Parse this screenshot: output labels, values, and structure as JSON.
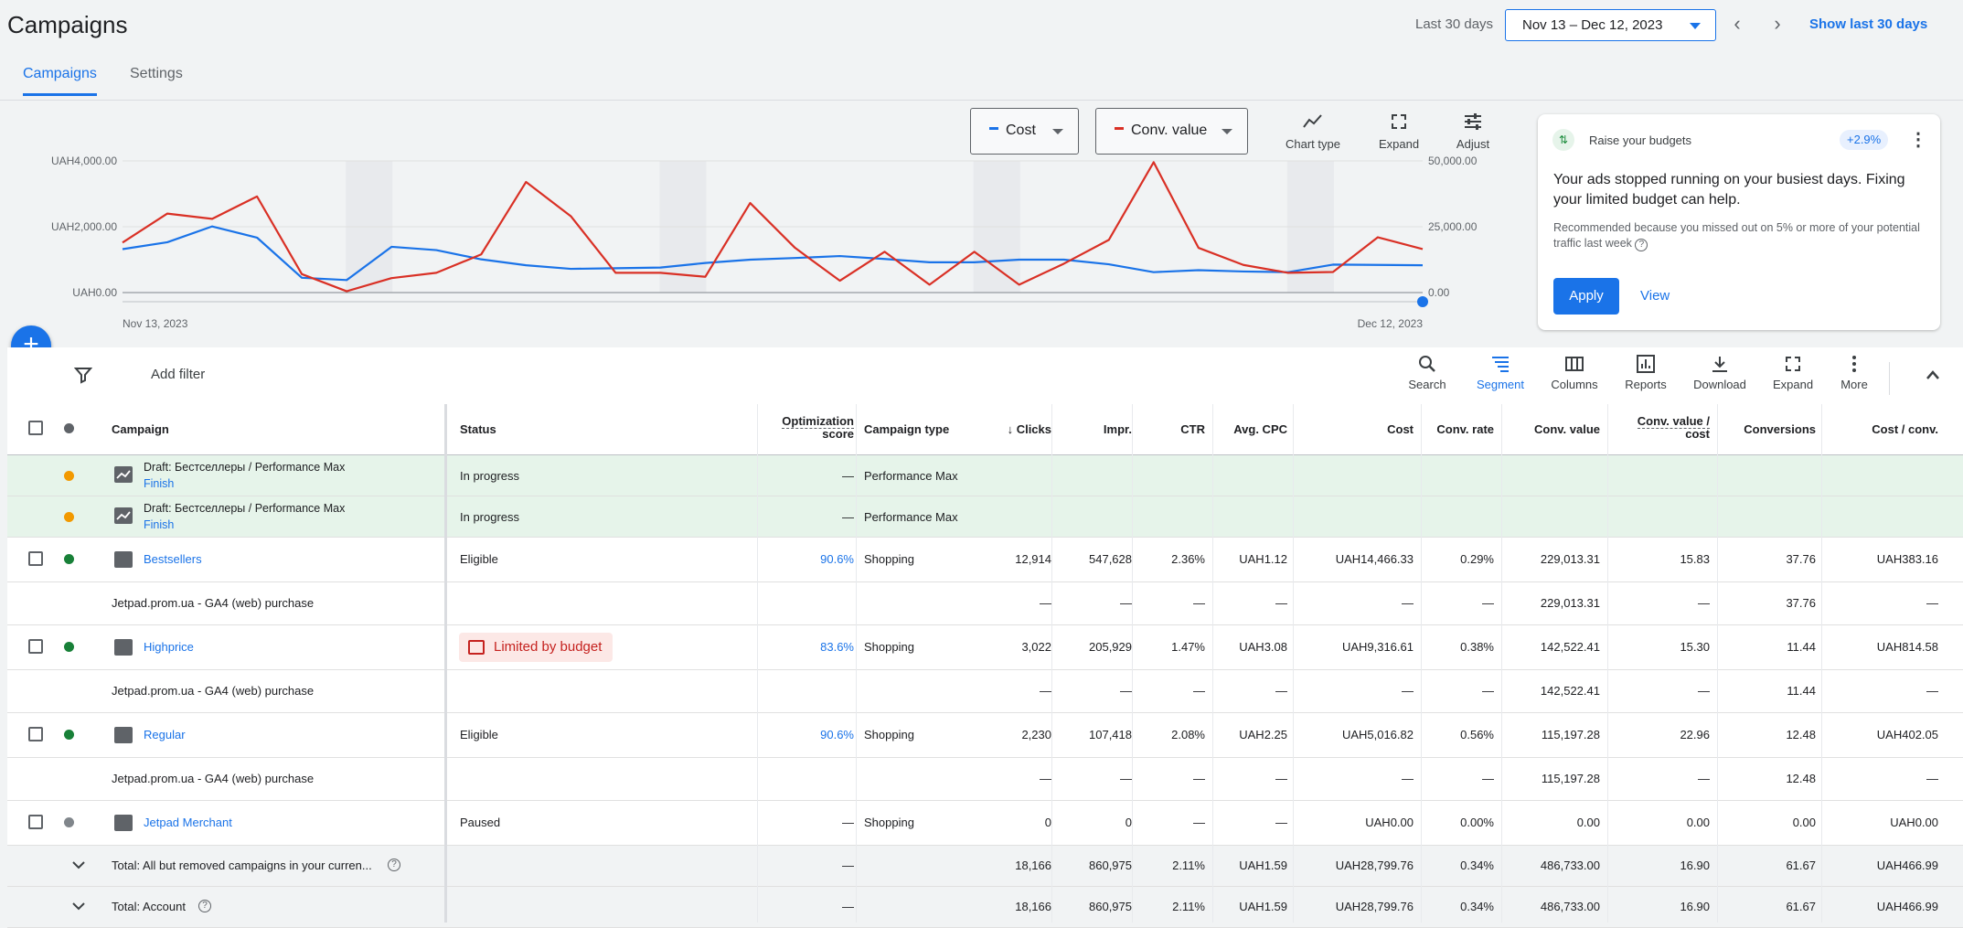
{
  "header": {
    "title": "Campaigns",
    "range_label": "Last 30 days",
    "date_range": "Nov 13 – Dec 12, 2023",
    "show_last": "Show last 30 days"
  },
  "tabs": [
    {
      "label": "Campaigns"
    },
    {
      "label": "Settings"
    }
  ],
  "chart_controls": {
    "metric1": "Cost",
    "metric2": "Conv. value",
    "chart_type": "Chart type",
    "expand": "Expand",
    "adjust": "Adjust",
    "metric1_color": "#1a73e8",
    "metric2_color": "#d93025"
  },
  "chart_data": {
    "type": "line",
    "x_start": "Nov 13, 2023",
    "x_end": "Dec 12, 2023",
    "left_ticks": [
      "UAH4,000.00",
      "UAH2,000.00",
      "UAH0.00"
    ],
    "right_ticks": [
      "50,000.00",
      "25,000.00",
      "0.00"
    ],
    "ylim_left": [
      0,
      4000
    ],
    "ylim_right": [
      0,
      50000
    ],
    "series": [
      {
        "name": "Cost",
        "axis": "left",
        "color": "#1a73e8",
        "values": [
          1320,
          1530,
          2010,
          1670,
          450,
          380,
          1390,
          1290,
          1010,
          830,
          720,
          740,
          760,
          900,
          1000,
          1050,
          1110,
          1020,
          920,
          920,
          1000,
          1000,
          860,
          620,
          680,
          640,
          620,
          850,
          840,
          830
        ]
      },
      {
        "name": "Conv. value",
        "axis": "right",
        "color": "#d93025",
        "values": [
          19000,
          30000,
          28000,
          36500,
          7000,
          500,
          5500,
          7500,
          14500,
          42000,
          29000,
          7500,
          7500,
          6000,
          34000,
          17000,
          4500,
          15500,
          3000,
          15500,
          3000,
          11000,
          20000,
          49500,
          17000,
          10500,
          7500,
          7800,
          21000,
          16500
        ]
      }
    ]
  },
  "recommendation": {
    "title": "Raise your budgets",
    "badge": "+2.9%",
    "headline": "Your ads stopped running on your busiest days. Fixing your limited budget can help.",
    "detail": "Recommended because you missed out on 5% or more of your potential traffic last week",
    "apply": "Apply",
    "view": "View"
  },
  "filter": {
    "label": "Add filter"
  },
  "toolbar": [
    {
      "label": "Search"
    },
    {
      "label": "Segment"
    },
    {
      "label": "Columns"
    },
    {
      "label": "Reports"
    },
    {
      "label": "Download"
    },
    {
      "label": "Expand"
    },
    {
      "label": "More"
    }
  ],
  "columns": {
    "campaign": "Campaign",
    "status": "Status",
    "opt1": "Optimization",
    "opt2": "score",
    "type": "Campaign type",
    "clicks": "Clicks",
    "impr": "Impr.",
    "ctr": "CTR",
    "cpc": "Avg. CPC",
    "cost": "Cost",
    "conv_rate": "Conv. rate",
    "conv_value": "Conv. value",
    "cvc1": "Conv. value /",
    "cvc2": "cost",
    "conversions": "Conversions",
    "cost_conv": "Cost / conv."
  },
  "drafts": [
    {
      "name": "Draft: Бестселлеры / Performance Max",
      "link": "Finish",
      "status": "In progress",
      "opt": "—",
      "type": "Performance Max"
    },
    {
      "name": "Draft: Бестселлеры / Performance Max",
      "link": "Finish",
      "status": "In progress",
      "opt": "—",
      "type": "Performance Max"
    }
  ],
  "rows": [
    {
      "name": "Bestsellers",
      "status": "Eligible",
      "opt": "90.6%",
      "type": "Shopping",
      "clicks": "12,914",
      "impr": "547,628",
      "ctr": "2.36%",
      "cpc": "UAH1.12",
      "cost": "UAH14,466.33",
      "conv_rate": "0.29%",
      "conv_value": "229,013.31",
      "cvc": "15.83",
      "conversions": "37.76",
      "cost_conv": "UAH383.16"
    },
    {
      "name": "Jetpad.prom.ua - GA4 (web) purchase",
      "clicks": "—",
      "impr": "—",
      "ctr": "—",
      "cpc": "—",
      "cost": "—",
      "conv_rate": "—",
      "conv_value": "229,013.31",
      "cvc": "—",
      "conversions": "37.76",
      "cost_conv": "—"
    },
    {
      "name": "Highprice",
      "status": "Limited by budget",
      "opt": "83.6%",
      "type": "Shopping",
      "clicks": "3,022",
      "impr": "205,929",
      "ctr": "1.47%",
      "cpc": "UAH3.08",
      "cost": "UAH9,316.61",
      "conv_rate": "0.38%",
      "conv_value": "142,522.41",
      "cvc": "15.30",
      "conversions": "11.44",
      "cost_conv": "UAH814.58"
    },
    {
      "name": "Jetpad.prom.ua - GA4 (web) purchase",
      "clicks": "—",
      "impr": "—",
      "ctr": "—",
      "cpc": "—",
      "cost": "—",
      "conv_rate": "—",
      "conv_value": "142,522.41",
      "cvc": "—",
      "conversions": "11.44",
      "cost_conv": "—"
    },
    {
      "name": "Regular",
      "status": "Eligible",
      "opt": "90.6%",
      "type": "Shopping",
      "clicks": "2,230",
      "impr": "107,418",
      "ctr": "2.08%",
      "cpc": "UAH2.25",
      "cost": "UAH5,016.82",
      "conv_rate": "0.56%",
      "conv_value": "115,197.28",
      "cvc": "22.96",
      "conversions": "12.48",
      "cost_conv": "UAH402.05"
    },
    {
      "name": "Jetpad.prom.ua - GA4 (web) purchase",
      "clicks": "—",
      "impr": "—",
      "ctr": "—",
      "cpc": "—",
      "cost": "—",
      "conv_rate": "—",
      "conv_value": "115,197.28",
      "cvc": "—",
      "conversions": "12.48",
      "cost_conv": "—"
    },
    {
      "name": "Jetpad Merchant",
      "status": "Paused",
      "opt": "—",
      "type": "Shopping",
      "clicks": "0",
      "impr": "0",
      "ctr": "—",
      "cpc": "—",
      "cost": "UAH0.00",
      "conv_rate": "0.00%",
      "conv_value": "0.00",
      "cvc": "0.00",
      "conversions": "0.00",
      "cost_conv": "UAH0.00"
    }
  ],
  "totals": [
    {
      "name": "Total: All but removed campaigns in your curren...",
      "opt": "—",
      "clicks": "18,166",
      "impr": "860,975",
      "ctr": "2.11%",
      "cpc": "UAH1.59",
      "cost": "UAH28,799.76",
      "conv_rate": "0.34%",
      "conv_value": "486,733.00",
      "cvc": "16.90",
      "conversions": "61.67",
      "cost_conv": "UAH466.99"
    },
    {
      "name": "Total: Account",
      "opt": "—",
      "clicks": "18,166",
      "impr": "860,975",
      "ctr": "2.11%",
      "cpc": "UAH1.59",
      "cost": "UAH28,799.76",
      "conv_rate": "0.34%",
      "conv_value": "486,733.00",
      "cvc": "16.90",
      "conversions": "61.67",
      "cost_conv": "UAH466.99"
    }
  ]
}
